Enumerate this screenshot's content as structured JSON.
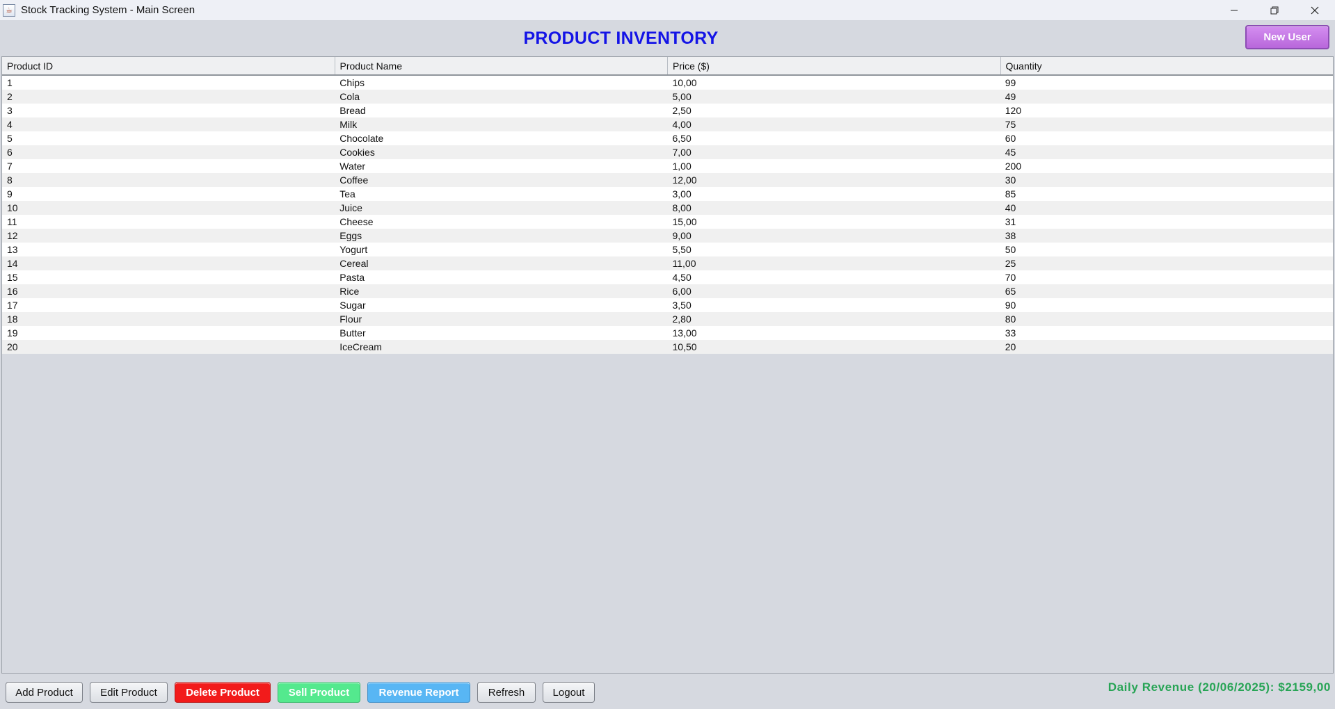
{
  "window": {
    "title": "Stock Tracking System - Main Screen",
    "controls": [
      "minimize-icon",
      "restore-icon",
      "close-icon"
    ]
  },
  "header": {
    "title": "PRODUCT INVENTORY",
    "new_user_label": "New User",
    "title_color": "#1414e6",
    "new_user_color": "#c77de6"
  },
  "table": {
    "columns": [
      "Product ID",
      "Product Name",
      "Price ($)",
      "Quantity"
    ],
    "rows": [
      [
        "1",
        "Chips",
        "10,00",
        "99"
      ],
      [
        "2",
        "Cola",
        "5,00",
        "49"
      ],
      [
        "3",
        "Bread",
        "2,50",
        "120"
      ],
      [
        "4",
        "Milk",
        "4,00",
        "75"
      ],
      [
        "5",
        "Chocolate",
        "6,50",
        "60"
      ],
      [
        "6",
        "Cookies",
        "7,00",
        "45"
      ],
      [
        "7",
        "Water",
        "1,00",
        "200"
      ],
      [
        "8",
        "Coffee",
        "12,00",
        "30"
      ],
      [
        "9",
        "Tea",
        "3,00",
        "85"
      ],
      [
        "10",
        "Juice",
        "8,00",
        "40"
      ],
      [
        "11",
        "Cheese",
        "15,00",
        "31"
      ],
      [
        "12",
        "Eggs",
        "9,00",
        "38"
      ],
      [
        "13",
        "Yogurt",
        "5,50",
        "50"
      ],
      [
        "14",
        "Cereal",
        "11,00",
        "25"
      ],
      [
        "15",
        "Pasta",
        "4,50",
        "70"
      ],
      [
        "16",
        "Rice",
        "6,00",
        "65"
      ],
      [
        "17",
        "Sugar",
        "3,50",
        "90"
      ],
      [
        "18",
        "Flour",
        "2,80",
        "80"
      ],
      [
        "19",
        "Butter",
        "13,00",
        "33"
      ],
      [
        "20",
        "IceCream",
        "10,50",
        "20"
      ]
    ]
  },
  "toolbar": {
    "add_label": "Add Product",
    "edit_label": "Edit Product",
    "delete_label": "Delete Product",
    "sell_label": "Sell Product",
    "report_label": "Revenue Report",
    "refresh_label": "Refresh",
    "logout_label": "Logout",
    "delete_color": "#f21b1b",
    "sell_color": "#54e98e",
    "report_color": "#58b6f4"
  },
  "status": {
    "daily_revenue": "Daily Revenue (20/06/2025): $2159,00",
    "revenue_color": "#27a455"
  }
}
